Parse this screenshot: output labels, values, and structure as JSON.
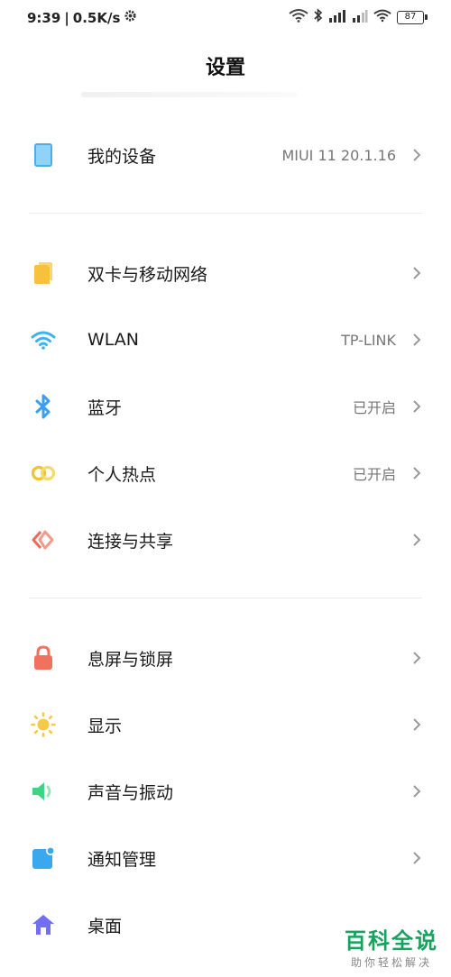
{
  "status_bar": {
    "time": "9:39",
    "separator": "|",
    "net_speed": "0.5K/s",
    "battery": "87"
  },
  "header": {
    "title": "设置"
  },
  "sections": [
    {
      "items": [
        {
          "label": "我的设备",
          "value": "MIUI 11 20.1.16",
          "icon": "phone-icon",
          "color": "#5ab8ef"
        }
      ]
    },
    {
      "items": [
        {
          "label": "双卡与移动网络",
          "value": "",
          "icon": "sim-card-icon",
          "color": "#f6c23e"
        },
        {
          "label": "WLAN",
          "value": "TP-LINK",
          "icon": "wifi-icon",
          "color": "#3db2f0"
        },
        {
          "label": "蓝牙",
          "value": "已开启",
          "icon": "bluetooth-icon",
          "color": "#3a9ef2"
        },
        {
          "label": "个人热点",
          "value": "已开启",
          "icon": "hotspot-icon",
          "color": "#f2c233"
        },
        {
          "label": "连接与共享",
          "value": "",
          "icon": "share-icon",
          "color": "#ef6a56"
        }
      ]
    },
    {
      "items": [
        {
          "label": "息屏与锁屏",
          "value": "",
          "icon": "lock-icon",
          "color": "#f2705e"
        },
        {
          "label": "显示",
          "value": "",
          "icon": "sun-icon",
          "color": "#f7c948"
        },
        {
          "label": "声音与振动",
          "value": "",
          "icon": "speaker-icon",
          "color": "#3ed483"
        },
        {
          "label": "通知管理",
          "value": "",
          "icon": "notification-icon",
          "color": "#3aa8ef"
        },
        {
          "label": "桌面",
          "value": "",
          "icon": "home-icon",
          "color": "#6f6ff0"
        }
      ]
    }
  ],
  "watermark": {
    "main": "百科全说",
    "sub": "助你轻松解决"
  }
}
